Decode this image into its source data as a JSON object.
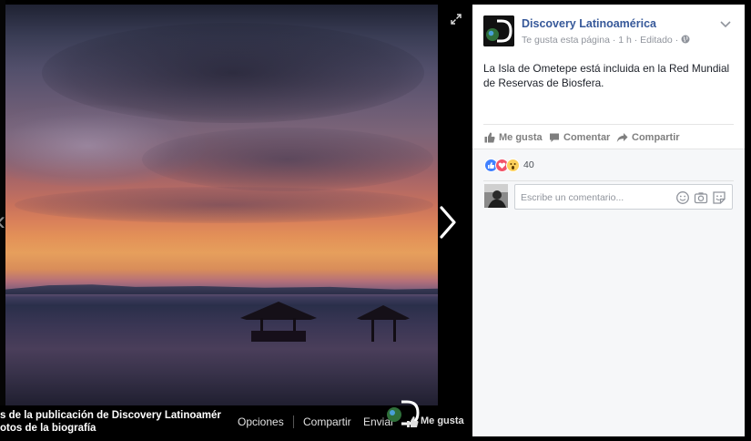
{
  "viewer": {
    "caption_line1": "s de la publicación de Discovery Latinoaméric",
    "caption_line2": "otos de la biografía",
    "actions": {
      "options": "Opciones",
      "share": "Compartir",
      "send": "Enviar",
      "like": "Me gusta"
    },
    "icons": [
      "expand-icon",
      "next-arrow-icon",
      "prev-arrow-icon",
      "discovery-logo-icon",
      "thumbs-up-icon"
    ]
  },
  "post": {
    "page_name": "Discovery Latinoamérica",
    "meta": "Te gusta esta página · 1 h · Editado · ",
    "text": "La Isla de Ometepe está incluida en la Red Mundial de Reservas de Biosfera.",
    "actions": {
      "like": "Me gusta",
      "comment": "Comentar",
      "share": "Compartir"
    },
    "reactions": {
      "types": [
        "like",
        "love",
        "wow"
      ],
      "count": "40"
    },
    "comment_placeholder": "Escribe un comentario...",
    "colors": {
      "link": "#365899",
      "meta": "#90949c",
      "like_reaction": "#4080ff",
      "love_reaction": "#f25268",
      "wow_reaction": "#fcd05c"
    }
  }
}
